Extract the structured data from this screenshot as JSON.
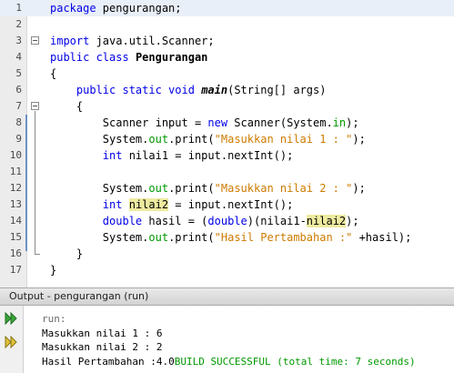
{
  "editor": {
    "lines": [
      {
        "num": "1",
        "parts": [
          {
            "t": "package",
            "c": "kw"
          },
          {
            "t": " pengurangan;",
            "c": ""
          }
        ]
      },
      {
        "num": "2",
        "parts": []
      },
      {
        "num": "3",
        "parts": [
          {
            "t": "import",
            "c": "kw"
          },
          {
            "t": " java.util.Scanner;",
            "c": ""
          }
        ]
      },
      {
        "num": "4",
        "parts": [
          {
            "t": "public class",
            "c": "kw"
          },
          {
            "t": " ",
            "c": ""
          },
          {
            "t": "Pengurangan",
            "c": "bold"
          }
        ]
      },
      {
        "num": "5",
        "parts": [
          {
            "t": "{",
            "c": ""
          }
        ]
      },
      {
        "num": "6",
        "parts": [
          {
            "t": "    ",
            "c": ""
          },
          {
            "t": "public static void",
            "c": "kw"
          },
          {
            "t": " ",
            "c": ""
          },
          {
            "t": "main",
            "c": "bi"
          },
          {
            "t": "(String[] args)",
            "c": ""
          }
        ]
      },
      {
        "num": "7",
        "parts": [
          {
            "t": "    {",
            "c": ""
          }
        ]
      },
      {
        "num": "8",
        "parts": [
          {
            "t": "        Scanner input = ",
            "c": ""
          },
          {
            "t": "new",
            "c": "kw"
          },
          {
            "t": " Scanner(System.",
            "c": ""
          },
          {
            "t": "in",
            "c": "fld"
          },
          {
            "t": ");",
            "c": ""
          }
        ]
      },
      {
        "num": "9",
        "parts": [
          {
            "t": "        System.",
            "c": ""
          },
          {
            "t": "out",
            "c": "fld"
          },
          {
            "t": ".print(",
            "c": ""
          },
          {
            "t": "\"Masukkan nilai 1 : \"",
            "c": "str"
          },
          {
            "t": ");",
            "c": ""
          }
        ]
      },
      {
        "num": "10",
        "parts": [
          {
            "t": "        ",
            "c": ""
          },
          {
            "t": "int",
            "c": "kw"
          },
          {
            "t": " nilai1 = input.nextInt();",
            "c": ""
          }
        ]
      },
      {
        "num": "11",
        "parts": []
      },
      {
        "num": "12",
        "parts": [
          {
            "t": "        System.",
            "c": ""
          },
          {
            "t": "out",
            "c": "fld"
          },
          {
            "t": ".print(",
            "c": ""
          },
          {
            "t": "\"Masukkan nilai 2 : \"",
            "c": "str"
          },
          {
            "t": ");",
            "c": ""
          }
        ]
      },
      {
        "num": "13",
        "parts": [
          {
            "t": "        ",
            "c": ""
          },
          {
            "t": "int",
            "c": "kw"
          },
          {
            "t": " ",
            "c": ""
          },
          {
            "t": "nilai2",
            "c": "mark"
          },
          {
            "t": " = input.nextInt();",
            "c": ""
          }
        ]
      },
      {
        "num": "14",
        "parts": [
          {
            "t": "        ",
            "c": ""
          },
          {
            "t": "double",
            "c": "kw"
          },
          {
            "t": " hasil = (",
            "c": ""
          },
          {
            "t": "double",
            "c": "kw"
          },
          {
            "t": ")(nilai1-",
            "c": ""
          },
          {
            "t": "nilai2",
            "c": "mark"
          },
          {
            "t": ");",
            "c": ""
          }
        ]
      },
      {
        "num": "15",
        "parts": [
          {
            "t": "        System.",
            "c": ""
          },
          {
            "t": "out",
            "c": "fld"
          },
          {
            "t": ".print(",
            "c": ""
          },
          {
            "t": "\"Hasil Pertambahan :\"",
            "c": "str"
          },
          {
            "t": " +hasil);",
            "c": ""
          }
        ]
      },
      {
        "num": "16",
        "parts": [
          {
            "t": "    }",
            "c": ""
          }
        ]
      },
      {
        "num": "17",
        "parts": [
          {
            "t": "}",
            "c": ""
          }
        ]
      }
    ]
  },
  "output": {
    "title": "Output - pengurangan (run)",
    "toolbar": [
      {
        "icon": "rerun-icon",
        "label": "Re-run"
      },
      {
        "icon": "rerun-with-params-icon",
        "label": "Re-run with different parameters"
      }
    ],
    "lines": [
      {
        "text": "run:",
        "muted": true
      },
      {
        "text": "Masukkan nilai 1 : 6",
        "muted": false
      },
      {
        "text": "Masukkan nilai 2 : 2",
        "muted": false
      }
    ],
    "result_prefix": "Hasil Pertambahan :4.0",
    "result_success": "BUILD SUCCESSFUL (total time: 7 seconds)"
  }
}
